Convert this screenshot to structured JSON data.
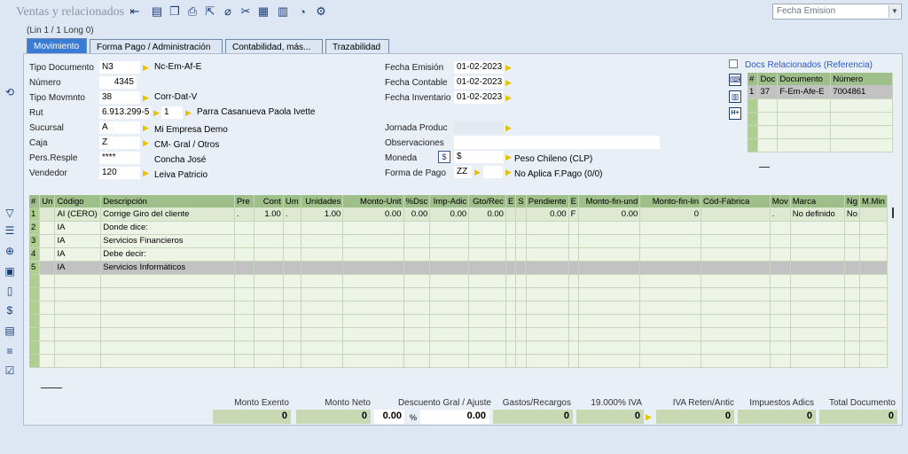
{
  "app": {
    "title": "Ventas y relacionados"
  },
  "toolbar": {
    "icons": [
      "back-icon",
      "save-icon",
      "copy-icon",
      "print-icon",
      "export-icon",
      "zoom-icon",
      "tools-icon",
      "grid-icon",
      "barcode-icon",
      "comment-icon",
      "settings-icon"
    ]
  },
  "sort_select": {
    "value": "Fecha Emision"
  },
  "line_info": "(Lin 1 / 1 Long 0)",
  "tabs": [
    {
      "label": "Movimiento",
      "active": true
    },
    {
      "label": "Forma Pago / Administración",
      "active": false
    },
    {
      "label": "Contabilidad, más...",
      "active": false
    },
    {
      "label": "Trazabilidad",
      "active": false
    }
  ],
  "form": {
    "tipo_documento": {
      "label": "Tipo Documento",
      "code": "N3",
      "desc": "Nc-Em-Af-E"
    },
    "numero": {
      "label": "Número",
      "value": "4345"
    },
    "tipo_movimiento": {
      "label": "Tipo Movmnto",
      "code": "38",
      "desc": "Corr-Dat-V"
    },
    "rut": {
      "label": "Rut",
      "value": "6.913.299-5",
      "seq": "1",
      "name": "Parra Casanueva Paola Ivette"
    },
    "sucursal": {
      "label": "Sucursal",
      "code": "A",
      "desc": "Mi Empresa Demo"
    },
    "caja": {
      "label": "Caja",
      "code": "Z",
      "desc": "CM- Gral / Otros"
    },
    "pers_resp": {
      "label": "Pers.Resple",
      "code": "****",
      "desc": "Concha José"
    },
    "vendedor": {
      "label": "Vendedor",
      "code": "120",
      "desc": "Leiva Patricio"
    },
    "fecha_emision": {
      "label": "Fecha Emisión",
      "value": "01-02-2023"
    },
    "fecha_contable": {
      "label": "Fecha Contable",
      "value": "01-02-2023"
    },
    "fecha_inventario": {
      "label": "Fecha Inventario",
      "value": "01-02-2023"
    },
    "jornada": {
      "label": "Jornada Produc",
      "value": ""
    },
    "observaciones": {
      "label": "Observaciones",
      "value": ""
    },
    "moneda": {
      "label": "Moneda",
      "symbol": "$",
      "desc": "Peso Chileno (CLP)"
    },
    "forma_pago": {
      "label": "Forma de Pago",
      "code": "ZZ",
      "desc": "No Aplica F.Pago (0/0)"
    }
  },
  "docs_relacionados": {
    "label": "Docs Relacionados (Referencia)",
    "headers": [
      "#",
      "Doc",
      "Documento",
      "Número"
    ],
    "rows": [
      {
        "n": "1",
        "doc": "37",
        "documento": "F-Em-Afe-E",
        "numero": "7004861"
      }
    ]
  },
  "grid": {
    "headers": [
      "#",
      "Un",
      "Código",
      "Descripción",
      "Pre",
      "Cont",
      "Um",
      "Unidades",
      "Monto-Unit",
      "%Dsc",
      "Imp-Adic",
      "Gto/Rec",
      "E",
      "S",
      "Pendiente",
      "E",
      "Monto-fin-und",
      "Monto-fin-lin",
      "Cód-Fábrica",
      "Mov",
      "Marca",
      "Ng",
      "M.Min"
    ],
    "rows": [
      {
        "n": "1",
        "un": "",
        "codigo": "AI (CERO)",
        "desc": "Corrige Giro del cliente",
        "pre": ".",
        "cont": "1.00",
        "um": ".",
        "unidades": "1.00",
        "monto_unit": "0.00",
        "dsc": "0.00",
        "imp": "0.00",
        "gto": "0.00",
        "e": "",
        "s": "",
        "pend": "0.00",
        "e2": "F",
        "mfu": "0.00",
        "mfl": "0",
        "cod_fab": "",
        "mov": ".",
        "marca": "No definido",
        "ng": "No",
        "mmin": ""
      },
      {
        "n": "2",
        "un": "",
        "codigo": "IA",
        "desc": "Donde dice:",
        "pre": "",
        "cont": "",
        "um": "",
        "unidades": "",
        "monto_unit": "",
        "dsc": "",
        "imp": "",
        "gto": "",
        "e": "",
        "s": "",
        "pend": "",
        "e2": "",
        "mfu": "",
        "mfl": "",
        "cod_fab": "",
        "mov": "",
        "marca": "",
        "ng": "",
        "mmin": ""
      },
      {
        "n": "3",
        "un": "",
        "codigo": "IA",
        "desc": "Servicios Financieros",
        "pre": "",
        "cont": "",
        "um": "",
        "unidades": "",
        "monto_unit": "",
        "dsc": "",
        "imp": "",
        "gto": "",
        "e": "",
        "s": "",
        "pend": "",
        "e2": "",
        "mfu": "",
        "mfl": "",
        "cod_fab": "",
        "mov": "",
        "marca": "",
        "ng": "",
        "mmin": ""
      },
      {
        "n": "4",
        "un": "",
        "codigo": "IA",
        "desc": "Debe decir:",
        "pre": "",
        "cont": "",
        "um": "",
        "unidades": "",
        "monto_unit": "",
        "dsc": "",
        "imp": "",
        "gto": "",
        "e": "",
        "s": "",
        "pend": "",
        "e2": "",
        "mfu": "",
        "mfl": "",
        "cod_fab": "",
        "mov": "",
        "marca": "",
        "ng": "",
        "mmin": ""
      },
      {
        "n": "5",
        "un": "",
        "codigo": "IA",
        "desc": "Servicios Informáticos",
        "pre": "",
        "cont": "",
        "um": "",
        "unidades": "",
        "monto_unit": "",
        "dsc": "",
        "imp": "",
        "gto": "",
        "e": "",
        "s": "",
        "pend": "",
        "e2": "",
        "mfu": "",
        "mfl": "",
        "cod_fab": "",
        "mov": "",
        "marca": "",
        "ng": "",
        "mmin": ""
      }
    ]
  },
  "totals": {
    "monto_exento": {
      "label": "Monto Exento",
      "value": "0"
    },
    "monto_neto": {
      "label": "Monto Neto",
      "value": "0"
    },
    "descuento": {
      "label": "Descuento Gral / Ajuste",
      "pct": "0.00",
      "pct_sign": "%",
      "value": "0.00"
    },
    "gastos": {
      "label": "Gastos/Recargos",
      "value": "0"
    },
    "iva": {
      "label": "19.000% IVA",
      "value": "0"
    },
    "iva_reten": {
      "label": "IVA Reten/Antic",
      "value": "0"
    },
    "impuestos": {
      "label": "Impuestos Adics",
      "value": "0"
    },
    "total": {
      "label": "Total Documento",
      "value": "0"
    }
  }
}
